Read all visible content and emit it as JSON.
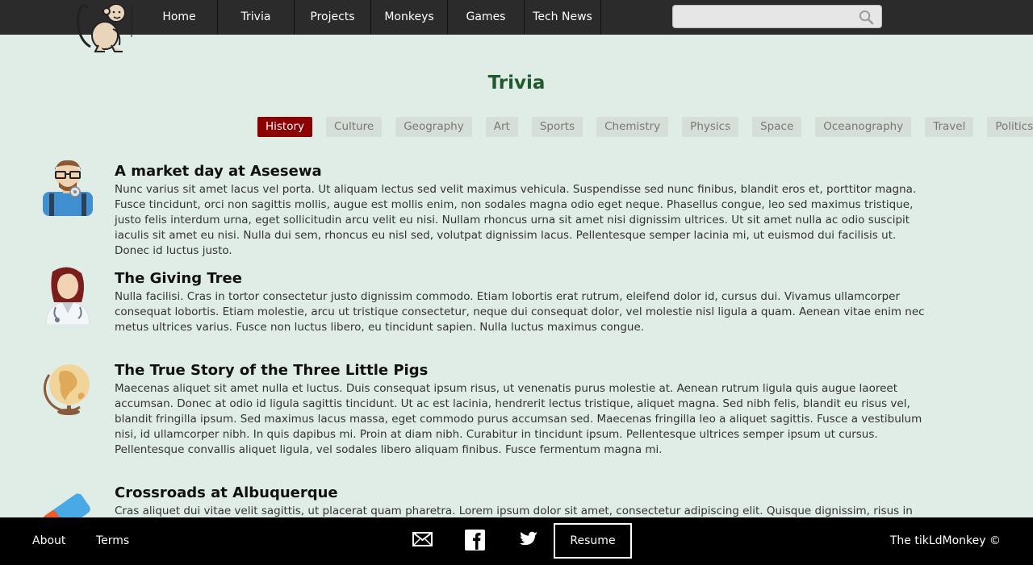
{
  "nav": {
    "items": [
      "Home",
      "Trivia",
      "Projects",
      "Monkeys",
      "Games",
      "Tech News"
    ]
  },
  "search": {
    "placeholder": "",
    "value": ""
  },
  "page": {
    "title": "Trivia"
  },
  "categories": {
    "active": "History",
    "items": [
      "History",
      "Culture",
      "Geography",
      "Art",
      "Sports",
      "Chemistry",
      "Physics",
      "Space",
      "Oceanography",
      "Travel",
      "Politics"
    ]
  },
  "articles": [
    {
      "icon": "man-with-glasses-icon",
      "title": "A market day at Asesewa",
      "text": "Nunc varius sit amet lacus vel porta. Ut aliquam lectus sed velit maximus vehicula. Suspendisse sed nunc finibus, blandit eros et, porttitor magna. Fusce tincidunt, orci non sagittis mollis, augue est mollis enim, non sodales magna odio eget neque. Phasellus congue, leo sed maximus tristique, justo felis interdum urna, eget sollicitudin arcu velit eu nisi. Nullam rhoncus urna sit amet nisi dignissim ultrices. Ut sit amet nulla ac odio suscipit iaculis sit amet eu nisi. Nulla dui sem, rhoncus eu nisl sed, volutpat dignissim lacus. Pellentesque semper lacinia mi, ut euismod dui facilisis ut. Donec id luctus justo."
    },
    {
      "icon": "woman-doctor-icon",
      "title": "The Giving Tree",
      "text": "Nulla facilisi. Cras in tortor consectetur justo dignissim commodo. Etiam lobortis erat rutrum, eleifend dolor id, cursus dui. Vivamus ullamcorper consequat lobortis. Etiam molestie, arcu ut tristique consectetur, neque dui consequat dolor, vel molestie nisl ligula a quam. Aenean vitae enim nec metus ultrices varius. Fusce non luctus libero, eu tincidunt sapien. Nulla luctus maximus congue."
    },
    {
      "icon": "globe-icon",
      "title": "The True Story of the Three Little Pigs",
      "text": "Maecenas aliquet sit amet nulla et luctus. Duis consequat ipsum risus, ut venenatis purus molestie at. Aenean rutrum ligula quis augue laoreet accumsan. Donec at odio id ligula sagittis tincidunt. Ut ac est lacinia, hendrerit lectus tristique, aliquet magna. Sed nibh felis, blandit eu risus vel, blandit fringilla ipsum. Sed maximus lacus massa, eget commodo purus accumsan sed. Maecenas fringilla leo a aliquet sagittis. Fusce a vestibulum nisi, id ullamcorper nibh. In quis dapibus mi. Proin at diam nibh. Curabitur in tincidunt ipsum. Pellentesque ultrices semper ipsum ut cursus. Pellentesque convallis aliquet ligula, vel sodales libero aliquam finibus. Fusce fermentum magna mi."
    },
    {
      "icon": "eraser-icon",
      "title": "Crossroads at Albuquerque",
      "text": "Cras aliquet dui vitae velit sagittis, ut placerat quam pharetra. Lorem ipsum dolor sit amet, consectetur adipiscing elit. Quisque dignissim, risus in porttitor"
    }
  ],
  "footer": {
    "about": "About",
    "terms": "Terms",
    "resume": "Resume",
    "copyright": "The tikLdMonkey ©"
  },
  "colors": {
    "background": "#e0ece6",
    "topbar": "#2b2b2b",
    "title": "#1d5a2c",
    "active_category": "#8b0000",
    "footer": "#000000"
  }
}
